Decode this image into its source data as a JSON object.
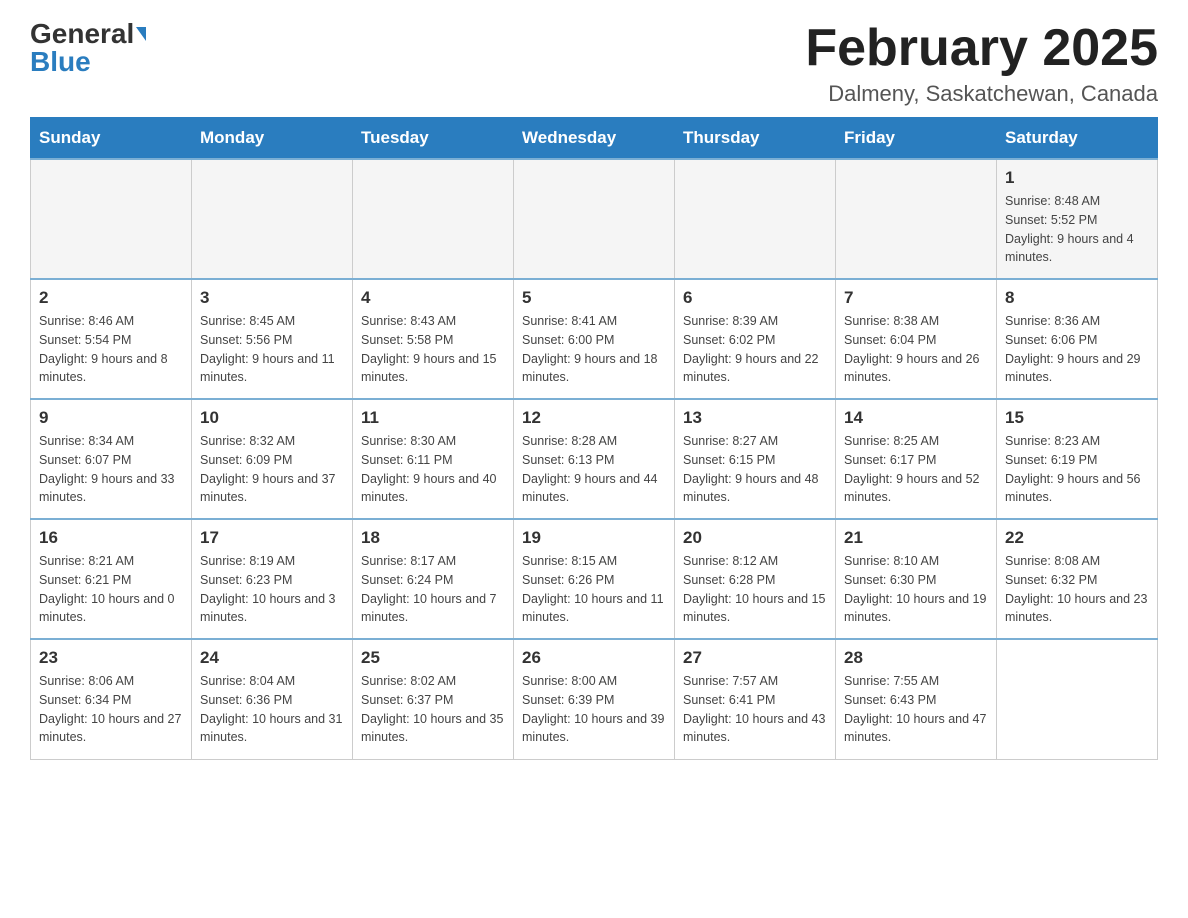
{
  "header": {
    "logo_general": "General",
    "logo_blue": "Blue",
    "month_title": "February 2025",
    "location": "Dalmeny, Saskatchewan, Canada"
  },
  "weekdays": [
    "Sunday",
    "Monday",
    "Tuesday",
    "Wednesday",
    "Thursday",
    "Friday",
    "Saturday"
  ],
  "weeks": [
    [
      {
        "day": "",
        "info": ""
      },
      {
        "day": "",
        "info": ""
      },
      {
        "day": "",
        "info": ""
      },
      {
        "day": "",
        "info": ""
      },
      {
        "day": "",
        "info": ""
      },
      {
        "day": "",
        "info": ""
      },
      {
        "day": "1",
        "info": "Sunrise: 8:48 AM\nSunset: 5:52 PM\nDaylight: 9 hours and 4 minutes."
      }
    ],
    [
      {
        "day": "2",
        "info": "Sunrise: 8:46 AM\nSunset: 5:54 PM\nDaylight: 9 hours and 8 minutes."
      },
      {
        "day": "3",
        "info": "Sunrise: 8:45 AM\nSunset: 5:56 PM\nDaylight: 9 hours and 11 minutes."
      },
      {
        "day": "4",
        "info": "Sunrise: 8:43 AM\nSunset: 5:58 PM\nDaylight: 9 hours and 15 minutes."
      },
      {
        "day": "5",
        "info": "Sunrise: 8:41 AM\nSunset: 6:00 PM\nDaylight: 9 hours and 18 minutes."
      },
      {
        "day": "6",
        "info": "Sunrise: 8:39 AM\nSunset: 6:02 PM\nDaylight: 9 hours and 22 minutes."
      },
      {
        "day": "7",
        "info": "Sunrise: 8:38 AM\nSunset: 6:04 PM\nDaylight: 9 hours and 26 minutes."
      },
      {
        "day": "8",
        "info": "Sunrise: 8:36 AM\nSunset: 6:06 PM\nDaylight: 9 hours and 29 minutes."
      }
    ],
    [
      {
        "day": "9",
        "info": "Sunrise: 8:34 AM\nSunset: 6:07 PM\nDaylight: 9 hours and 33 minutes."
      },
      {
        "day": "10",
        "info": "Sunrise: 8:32 AM\nSunset: 6:09 PM\nDaylight: 9 hours and 37 minutes."
      },
      {
        "day": "11",
        "info": "Sunrise: 8:30 AM\nSunset: 6:11 PM\nDaylight: 9 hours and 40 minutes."
      },
      {
        "day": "12",
        "info": "Sunrise: 8:28 AM\nSunset: 6:13 PM\nDaylight: 9 hours and 44 minutes."
      },
      {
        "day": "13",
        "info": "Sunrise: 8:27 AM\nSunset: 6:15 PM\nDaylight: 9 hours and 48 minutes."
      },
      {
        "day": "14",
        "info": "Sunrise: 8:25 AM\nSunset: 6:17 PM\nDaylight: 9 hours and 52 minutes."
      },
      {
        "day": "15",
        "info": "Sunrise: 8:23 AM\nSunset: 6:19 PM\nDaylight: 9 hours and 56 minutes."
      }
    ],
    [
      {
        "day": "16",
        "info": "Sunrise: 8:21 AM\nSunset: 6:21 PM\nDaylight: 10 hours and 0 minutes."
      },
      {
        "day": "17",
        "info": "Sunrise: 8:19 AM\nSunset: 6:23 PM\nDaylight: 10 hours and 3 minutes."
      },
      {
        "day": "18",
        "info": "Sunrise: 8:17 AM\nSunset: 6:24 PM\nDaylight: 10 hours and 7 minutes."
      },
      {
        "day": "19",
        "info": "Sunrise: 8:15 AM\nSunset: 6:26 PM\nDaylight: 10 hours and 11 minutes."
      },
      {
        "day": "20",
        "info": "Sunrise: 8:12 AM\nSunset: 6:28 PM\nDaylight: 10 hours and 15 minutes."
      },
      {
        "day": "21",
        "info": "Sunrise: 8:10 AM\nSunset: 6:30 PM\nDaylight: 10 hours and 19 minutes."
      },
      {
        "day": "22",
        "info": "Sunrise: 8:08 AM\nSunset: 6:32 PM\nDaylight: 10 hours and 23 minutes."
      }
    ],
    [
      {
        "day": "23",
        "info": "Sunrise: 8:06 AM\nSunset: 6:34 PM\nDaylight: 10 hours and 27 minutes."
      },
      {
        "day": "24",
        "info": "Sunrise: 8:04 AM\nSunset: 6:36 PM\nDaylight: 10 hours and 31 minutes."
      },
      {
        "day": "25",
        "info": "Sunrise: 8:02 AM\nSunset: 6:37 PM\nDaylight: 10 hours and 35 minutes."
      },
      {
        "day": "26",
        "info": "Sunrise: 8:00 AM\nSunset: 6:39 PM\nDaylight: 10 hours and 39 minutes."
      },
      {
        "day": "27",
        "info": "Sunrise: 7:57 AM\nSunset: 6:41 PM\nDaylight: 10 hours and 43 minutes."
      },
      {
        "day": "28",
        "info": "Sunrise: 7:55 AM\nSunset: 6:43 PM\nDaylight: 10 hours and 47 minutes."
      },
      {
        "day": "",
        "info": ""
      }
    ]
  ]
}
